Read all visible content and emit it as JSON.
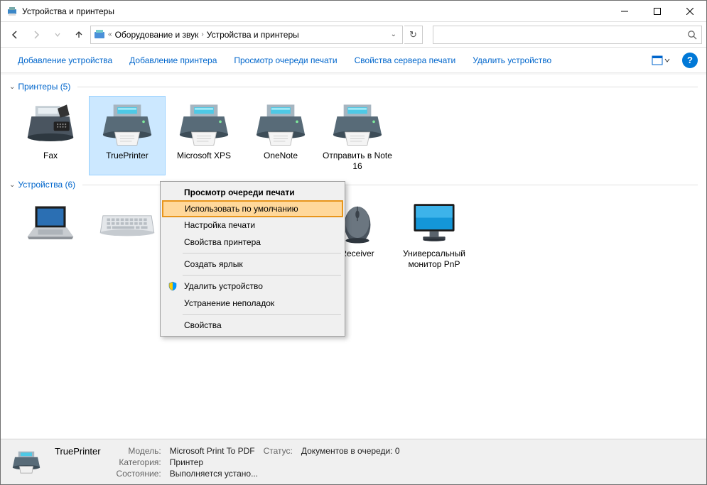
{
  "window": {
    "title": "Устройства и принтеры"
  },
  "breadcrumb": {
    "part1": "Оборудование и звук",
    "part2": "Устройства и принтеры"
  },
  "search": {
    "placeholder": ""
  },
  "commands": {
    "add_device": "Добавление устройства",
    "add_printer": "Добавление принтера",
    "view_queue": "Просмотр очереди печати",
    "server_props": "Свойства сервера печати",
    "remove_device": "Удалить устройство"
  },
  "groups": {
    "printers": {
      "label": "Принтеры (5)"
    },
    "devices": {
      "label": "Устройства (6)"
    }
  },
  "printers": [
    {
      "label": "Fax",
      "kind": "fax"
    },
    {
      "label": "TruePrinter",
      "kind": "printer",
      "selected": true
    },
    {
      "label": "Microsoft XPS",
      "kind": "printer"
    },
    {
      "label": "OneNote",
      "kind": "printer"
    },
    {
      "label": "Отправить в Note 16",
      "kind": "printer"
    }
  ],
  "devices": [
    {
      "label": "",
      "kind": "laptop"
    },
    {
      "label": "",
      "kind": "keyboard"
    },
    {
      "label": "",
      "kind": "disk"
    },
    {
      "label": "",
      "kind": "webcam"
    },
    {
      "label": "Receiver",
      "kind": "mouse"
    },
    {
      "label": "Универсальный монитор PnP",
      "kind": "monitor"
    }
  ],
  "context_menu": {
    "view_queue": "Просмотр очереди печати",
    "set_default": "Использовать по умолчанию",
    "print_prefs": "Настройка печати",
    "printer_props": "Свойства принтера",
    "create_shortcut": "Создать ярлык",
    "remove_device": "Удалить устройство",
    "troubleshoot": "Устранение неполадок",
    "properties": "Свойства"
  },
  "status": {
    "name": "TruePrinter",
    "model_label": "Модель:",
    "model_value": "Microsoft Print To PDF",
    "category_label": "Категория:",
    "category_value": "Принтер",
    "state_label": "Состояние:",
    "state_value": "Выполняется устано...",
    "status_label": "Статус:",
    "status_value": "Документов в очереди: 0"
  }
}
